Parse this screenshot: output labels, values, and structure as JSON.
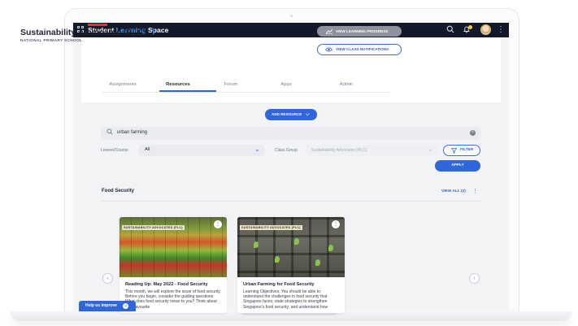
{
  "app": {
    "brand_prefix": "Student ",
    "brand_highlight": "Learning",
    "brand_suffix": " Space",
    "icons": [
      "grid-icon",
      "search-icon",
      "bell-icon",
      "avatar",
      "more-icon"
    ]
  },
  "header": {
    "group_title": "Sustainability Advocates (PLC)",
    "school": "NATIONAL PRIMARY SCHOOL",
    "btn_progress": "VIEW LEARNING PROGRESS",
    "btn_notifications": "VIEW CLASS NOTIFICATIONS"
  },
  "tabs": [
    {
      "label": "Assignments"
    },
    {
      "label": "Resources"
    },
    {
      "label": "Forum"
    },
    {
      "label": "Apps"
    },
    {
      "label": "Admin"
    }
  ],
  "resources": {
    "add_button": "ADD RESOURCE",
    "search_value": "urban farming",
    "lesson_label": "Lesson/Course",
    "lesson_value": "All",
    "class_label": "Class Group",
    "class_value": "Sustainability Advocates (PLC)",
    "filter_label": "FILTER",
    "apply_label": "APPLY"
  },
  "section": {
    "title": "Food Security",
    "view_all": "VIEW ALL (2)"
  },
  "cards": [
    {
      "tag": "SUSTAINABILITY ADVOCATES (PLC)",
      "title": "Reading Up: May 2022 - Food Security",
      "desc": "This month, we will explore the issue of food security. Before you begin, consider the guiding questions: What does food security mean to you? Think about your favourite"
    },
    {
      "tag": "SUSTAINABILITY ADVOCATES (PLC)",
      "title": "Urban Farming for Food Security",
      "desc": "Learning Objectives: You should be able to: understand the challenges in food security that Singapore faces; state strategies to strengthen Singapore's food security; and understand how"
    }
  ],
  "help": {
    "label": "Help us improve"
  },
  "colors": {
    "accent": "#2f66d9",
    "topbar": "#13182a",
    "progress_btn": "#8e929c"
  }
}
